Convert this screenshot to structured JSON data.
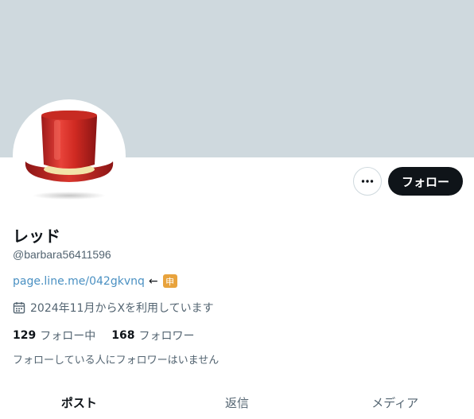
{
  "profile": {
    "display_name": "レッド",
    "handle": "@barbara56411596",
    "bio_link": "page.line.me/042gkvnq",
    "bio_arrow": "←",
    "bio_badge": "申",
    "joined": "2024年11月からXを利用しています",
    "avatar_icon": "red-top-hat-icon"
  },
  "actions": {
    "more_icon": "more-options-icon",
    "follow_label": "フォロー"
  },
  "stats": {
    "following_count": "129",
    "following_label": "フォロー中",
    "followers_count": "168",
    "followers_label": "フォロワー"
  },
  "followers_note": "フォローしている人にフォロワーはいません",
  "tabs": [
    {
      "label": "ポスト",
      "active": true
    },
    {
      "label": "返信",
      "active": false
    },
    {
      "label": "メディア",
      "active": false
    }
  ],
  "colors": {
    "banner": "#cfd9de",
    "link": "#4a90c2",
    "badge": "#e8a33d",
    "follow_button": "#0f1419"
  }
}
